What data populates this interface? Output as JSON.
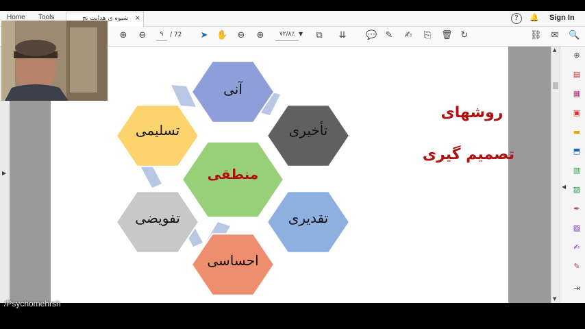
{
  "app": {
    "menu": {
      "home": "Home",
      "tools": "Tools"
    },
    "doc_tab_title": "شیوه ی هدایت تج",
    "doc_tab_close": "×",
    "help": "?",
    "sign_in": "Sign In"
  },
  "toolbar": {
    "page_current": "۹",
    "page_total": "/ 72",
    "zoom": "۷۲/۸٪"
  },
  "slide": {
    "title_line1": "روشهای",
    "title_line2": "تصمیم گیری",
    "hexagons": [
      {
        "id": "ani",
        "label": "آنی",
        "color": "#8e9ed8"
      },
      {
        "id": "takhiri",
        "label": "تأخیری",
        "color": "#606060"
      },
      {
        "id": "taqdiri",
        "label": "تقدیری",
        "color": "#8eb0e0"
      },
      {
        "id": "ehsasi",
        "label": "احساسی",
        "color": "#ef8e6e"
      },
      {
        "id": "tafvizi",
        "label": "تفویضی",
        "color": "#c8c8c8"
      },
      {
        "id": "taslimi",
        "label": "تسلیمی",
        "color": "#fcd36c"
      },
      {
        "id": "manteqi",
        "label": "منطقی",
        "color": "#98d07a"
      }
    ],
    "center_label_color": "#b01010"
  },
  "watermark": "/Psychomehrsh",
  "icons": [
    "back-arrow-icon",
    "forward-arrow-icon",
    "up-arrow-icon",
    "down-arrow-icon",
    "select-cursor-icon",
    "hand-icon",
    "zoom-out-icon",
    "zoom-in-icon",
    "fit-page-icon",
    "scroll-icon",
    "comment-icon",
    "pen-icon",
    "sign-icon",
    "stamp-icon",
    "delete-icon",
    "rotate-icon",
    "share-icon",
    "mail-icon",
    "search-icon"
  ]
}
